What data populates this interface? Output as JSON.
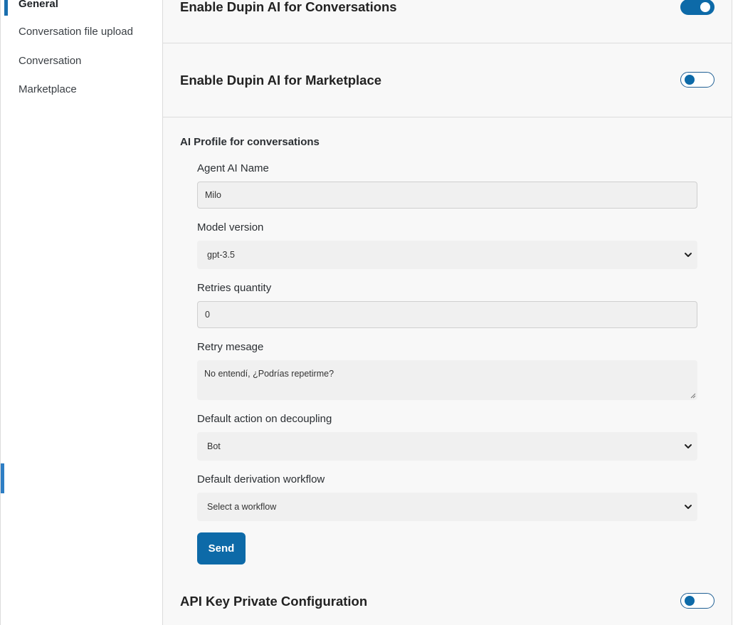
{
  "sidebar": {
    "items": [
      {
        "label": "General",
        "active": true
      },
      {
        "label": "Conversation file upload",
        "active": false
      },
      {
        "label": "Conversation",
        "active": false
      },
      {
        "label": "Marketplace",
        "active": false
      }
    ]
  },
  "settings": {
    "conversations": {
      "title": "Enable Dupin AI for Conversations",
      "enabled": true
    },
    "marketplace": {
      "title": "Enable Dupin AI for Marketplace",
      "enabled": false
    },
    "api_key": {
      "title": "API Key Private Configuration",
      "enabled": false
    }
  },
  "profile": {
    "title": "AI Profile for conversations",
    "agent_name": {
      "label": "Agent AI Name",
      "value": "Milo"
    },
    "model_version": {
      "label": "Model version",
      "value": "gpt-3.5"
    },
    "retries": {
      "label": "Retries quantity",
      "value": "0"
    },
    "retry_message": {
      "label": "Retry mesage",
      "value": "No entendí, ¿Podrías repetirme?"
    },
    "decoupling": {
      "label": "Default action on decoupling",
      "value": "Bot"
    },
    "derivation": {
      "label": "Default derivation workflow",
      "value": "Select a workflow"
    },
    "send_label": "Send"
  },
  "colors": {
    "accent": "#0d6aa8",
    "input_bg": "#f0f0f0",
    "page_bg": "#f8f8f8"
  },
  "icons": {
    "select_arrow": "chevron-down-icon",
    "textarea_resize": "resize-grip-icon"
  }
}
